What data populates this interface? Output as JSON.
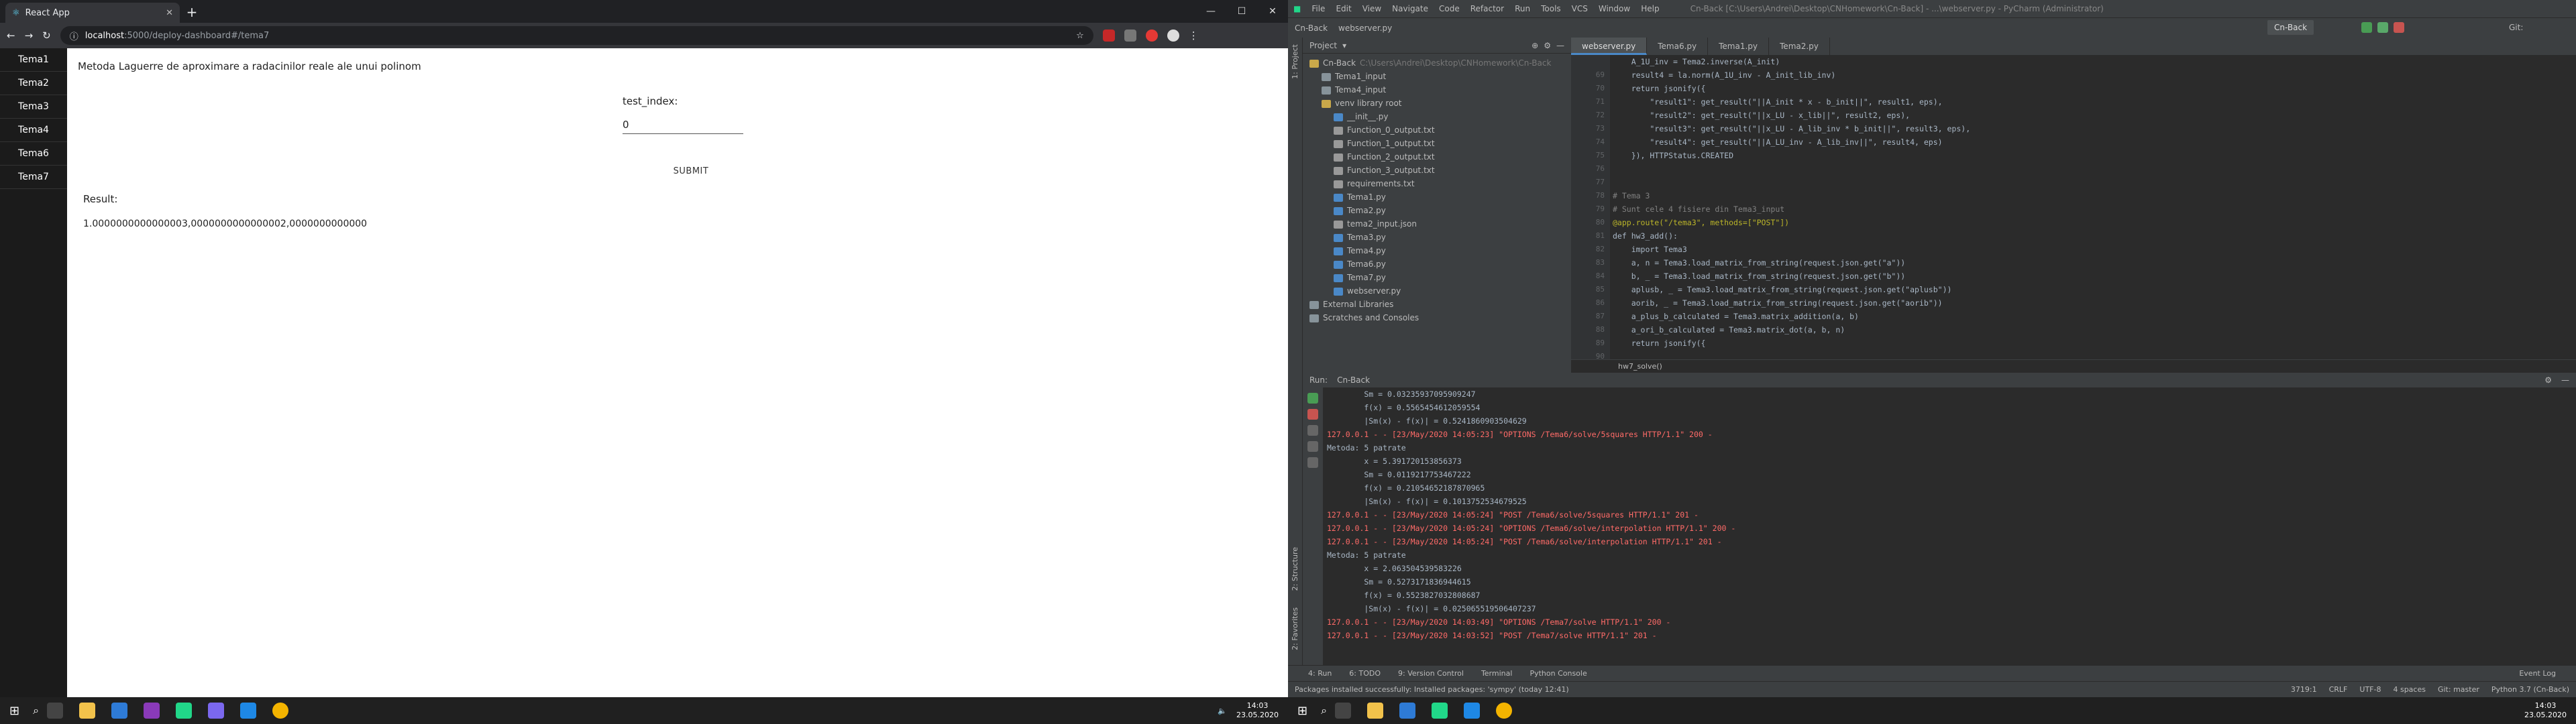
{
  "browser": {
    "tab_title": "React App",
    "url_host": "localhost",
    "url_path": ":5000/deploy-dashboard#/tema7",
    "sidebar": [
      "Tema1",
      "Tema2",
      "Tema3",
      "Tema4",
      "Tema6",
      "Tema7"
    ],
    "page": {
      "title": "Metoda Laguerre de aproximare a radacinilor reale ale unui polinom",
      "field_label": "test_index:",
      "field_value": "0",
      "submit_label": "SUBMIT",
      "result_label": "Result:",
      "result_value": "1.0000000000000003,0000000000000002,0000000000000"
    }
  },
  "ide": {
    "menu": [
      "File",
      "Edit",
      "View",
      "Navigate",
      "Code",
      "Refactor",
      "Run",
      "Tools",
      "VCS",
      "Window",
      "Help"
    ],
    "window_title": "Cn-Back [C:\\Users\\Andrei\\Desktop\\CNHomework\\Cn-Back] - ...\\webserver.py - PyCharm (Administrator)",
    "nav": [
      "Cn-Back",
      "webserver.py"
    ],
    "run_config": "Cn-Back",
    "git_label": "Git:",
    "project_label": "Project",
    "tree": [
      {
        "name": "Cn-Back",
        "path": "C:\\Users\\Andrei\\Desktop\\CNHomework\\Cn-Back",
        "indent": 0,
        "color": "#c9a84a"
      },
      {
        "name": "Tema1_input",
        "indent": 1,
        "color": "#87939a"
      },
      {
        "name": "Tema4_input",
        "indent": 1,
        "color": "#87939a"
      },
      {
        "name": "venv library root",
        "indent": 1,
        "color": "#c9a84a"
      },
      {
        "name": "__init__.py",
        "indent": 2,
        "color": "#4a88c7"
      },
      {
        "name": "Function_0_output.txt",
        "indent": 2,
        "color": "#999"
      },
      {
        "name": "Function_1_output.txt",
        "indent": 2,
        "color": "#999"
      },
      {
        "name": "Function_2_output.txt",
        "indent": 2,
        "color": "#999"
      },
      {
        "name": "Function_3_output.txt",
        "indent": 2,
        "color": "#999"
      },
      {
        "name": "requirements.txt",
        "indent": 2,
        "color": "#999"
      },
      {
        "name": "Tema1.py",
        "indent": 2,
        "color": "#4a88c7"
      },
      {
        "name": "Tema2.py",
        "indent": 2,
        "color": "#4a88c7"
      },
      {
        "name": "tema2_input.json",
        "indent": 2,
        "color": "#999"
      },
      {
        "name": "Tema3.py",
        "indent": 2,
        "color": "#4a88c7"
      },
      {
        "name": "Tema4.py",
        "indent": 2,
        "color": "#4a88c7"
      },
      {
        "name": "Tema6.py",
        "indent": 2,
        "color": "#4a88c7"
      },
      {
        "name": "Tema7.py",
        "indent": 2,
        "color": "#4a88c7"
      },
      {
        "name": "webserver.py",
        "indent": 2,
        "color": "#4a88c7"
      },
      {
        "name": "External Libraries",
        "indent": 0,
        "color": "#87939a"
      },
      {
        "name": "Scratches and Consoles",
        "indent": 0,
        "color": "#87939a"
      }
    ],
    "editor_tabs": [
      "webserver.py",
      "Tema6.py",
      "Tema1.py",
      "Tema2.py"
    ],
    "line_numbers": [
      "",
      "69",
      "70",
      "71",
      "72",
      "73",
      "74",
      "75",
      "76",
      "77",
      "78",
      "79",
      "80",
      "81",
      "82",
      "83",
      "84",
      "85",
      "86",
      "87",
      "88",
      "89",
      "90"
    ],
    "code_lines": [
      "    A_1U_inv = Tema2.inverse(A_init)",
      "    result4 = la.norm(A_1U_inv - A_init_lib_inv)",
      "    return jsonify({",
      "        \"result1\": get_result(\"||A_init * x - b_init||\", result1, eps),",
      "        \"result2\": get_result(\"||x_LU - x_lib||\", result2, eps),",
      "        \"result3\": get_result(\"||x_LU - A_lib_inv * b_init||\", result3, eps),",
      "        \"result4\": get_result(\"||A_LU_inv - A_lib_inv||\", result4, eps)",
      "    }), HTTPStatus.CREATED",
      "",
      "",
      "# Tema 3",
      "# Sunt cele 4 fisiere din Tema3_input",
      "@app.route(\"/tema3\", methods=[\"POST\"])",
      "def hw3_add():",
      "    import Tema3",
      "    a, n = Tema3.load_matrix_from_string(request.json.get(\"a\"))",
      "    b, _ = Tema3.load_matrix_from_string(request.json.get(\"b\"))",
      "    aplusb, _ = Tema3.load_matrix_from_string(request.json.get(\"aplusb\"))",
      "    aorib, _ = Tema3.load_matrix_from_string(request.json.get(\"aorib\"))",
      "    a_plus_b_calculated = Tema3.matrix_addition(a, b)",
      "    a_ori_b_calculated = Tema3.matrix_dot(a, b, n)",
      "    return jsonify({"
    ],
    "breadcrumb": "hw7_solve()",
    "run_label": "Run:",
    "run_config_tab": "Cn-Back",
    "console_lines": [
      {
        "t": "        Sm = 0.03235937095909247",
        "c": ""
      },
      {
        "t": "        f(x) = 0.5565454612059554",
        "c": ""
      },
      {
        "t": "        |Sm(x) - f(x)| = 0.5241860903504629",
        "c": ""
      },
      {
        "t": "127.0.0.1 - - [23/May/2020 14:05:23] \"OPTIONS /Tema6/solve/5squares HTTP/1.1\" 200 -",
        "c": "red"
      },
      {
        "t": "Metoda: 5 patrate",
        "c": ""
      },
      {
        "t": "        x = 5.391720153856373",
        "c": ""
      },
      {
        "t": "        Sm = 0.0119217753467222",
        "c": ""
      },
      {
        "t": "        f(x) = 0.21054652187870965",
        "c": ""
      },
      {
        "t": "        |Sm(x) - f(x)| = 0.1013752534679525",
        "c": ""
      },
      {
        "t": "127.0.0.1 - - [23/May/2020 14:05:24] \"POST /Tema6/solve/5squares HTTP/1.1\" 201 -",
        "c": "red"
      },
      {
        "t": "127.0.0.1 - - [23/May/2020 14:05:24] \"OPTIONS /Tema6/solve/interpolation HTTP/1.1\" 200 -",
        "c": "red"
      },
      {
        "t": "127.0.0.1 - - [23/May/2020 14:05:24] \"POST /Tema6/solve/interpolation HTTP/1.1\" 201 -",
        "c": "red"
      },
      {
        "t": "Metoda: 5 patrate",
        "c": ""
      },
      {
        "t": "        x = 2.063504539583226",
        "c": ""
      },
      {
        "t": "        Sm = 0.5273171836944615",
        "c": ""
      },
      {
        "t": "        f(x) = 0.5523827032808687",
        "c": ""
      },
      {
        "t": "        |Sm(x) - f(x)| = 0.025065519506407237",
        "c": ""
      },
      {
        "t": "127.0.0.1 - - [23/May/2020 14:03:49] \"OPTIONS /Tema7/solve HTTP/1.1\" 200 -",
        "c": "red"
      },
      {
        "t": "127.0.0.1 - - [23/May/2020 14:03:52] \"POST /Tema7/solve HTTP/1.1\" 201 -",
        "c": "red"
      }
    ],
    "bottom_tabs": [
      "4: Run",
      "6: TODO",
      "9: Version Control",
      "Terminal",
      "Python Console"
    ],
    "event_log": "Event Log",
    "status_message": "Packages installed successfully: Installed packages: 'sympy' (today 12:41)",
    "status_right": [
      "3719:1",
      "CRLF",
      "UTF-8",
      "4 spaces",
      "Git: master",
      "Python 3.7 (Cn-Back)"
    ],
    "side_labels": [
      "1: Project",
      "2: Structure",
      "2: Favorites"
    ]
  },
  "taskbar": {
    "time": "14:03",
    "date": "23.05.2020"
  }
}
